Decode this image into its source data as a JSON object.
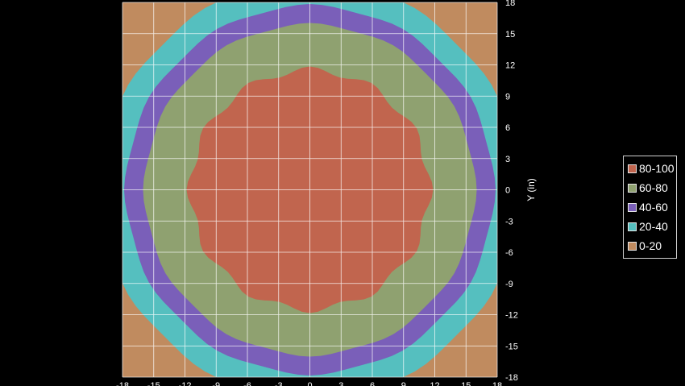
{
  "chart_data": {
    "type": "heatmap",
    "subtype": "filled-contour",
    "ylabel": "Y (in)",
    "xlabel": "",
    "xlim": [
      -18,
      18
    ],
    "ylim": [
      -18,
      18
    ],
    "xticks": [
      -18,
      -15,
      -12,
      -9,
      -6,
      -3,
      0,
      3,
      6,
      9,
      12,
      15,
      18
    ],
    "yticks": [
      18,
      15,
      12,
      9,
      6,
      3,
      0,
      -3,
      -6,
      -9,
      -12,
      -15,
      -18
    ],
    "y_axis_side": "right",
    "grid": true,
    "legend_position": "right",
    "levels": [
      {
        "label": "80-100",
        "color": "#c1654e",
        "outer_radius": 11.5
      },
      {
        "label": "60-80",
        "color": "#8fa170",
        "outer_radius": 15.9
      },
      {
        "label": "40-60",
        "color": "#7a5fb9",
        "outer_radius": 17.7
      },
      {
        "label": "20-40",
        "color": "#55bfbf",
        "outer_radius": 20.0
      },
      {
        "label": "0-20",
        "color": "#c08b5f",
        "outer_radius": null
      }
    ]
  },
  "legend": {
    "items": [
      {
        "label": "80-100",
        "color": "#c1654e"
      },
      {
        "label": "60-80",
        "color": "#8fa170"
      },
      {
        "label": "40-60",
        "color": "#7a5fb9"
      },
      {
        "label": "20-40",
        "color": "#55bfbf"
      },
      {
        "label": "0-20",
        "color": "#c08b5f"
      }
    ]
  }
}
